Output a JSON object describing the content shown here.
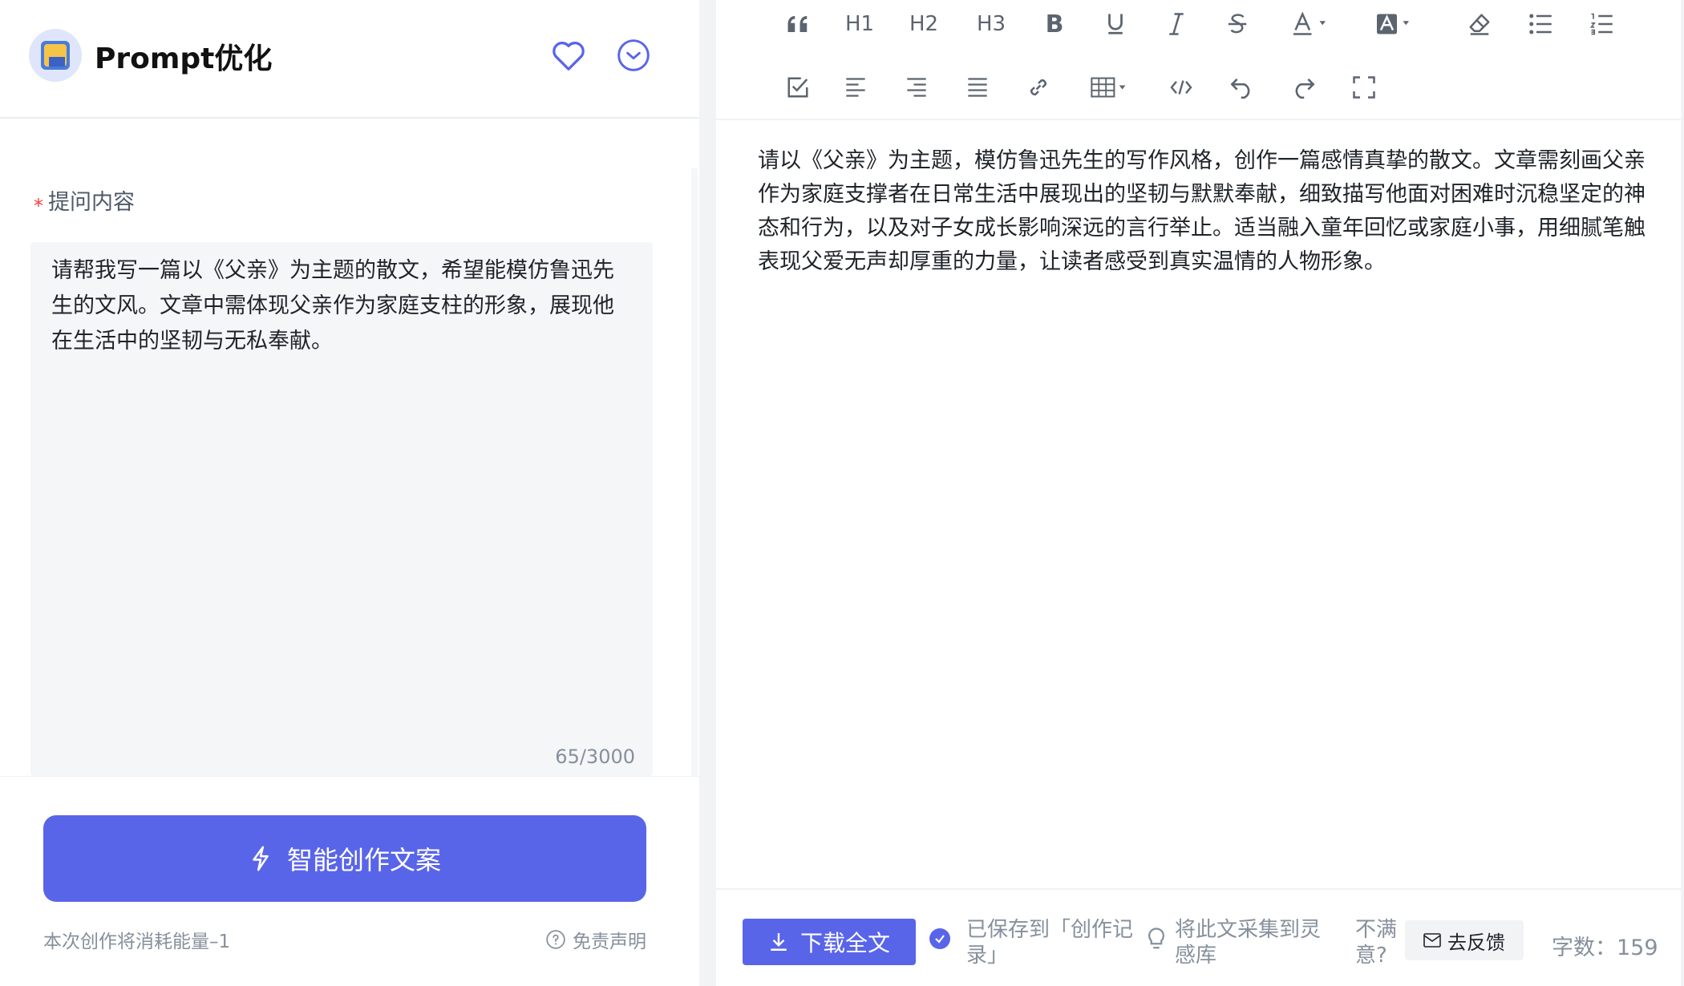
{
  "app": {
    "title": "Prompt优化"
  },
  "form": {
    "label": "提问内容",
    "required_mark": "*",
    "input_text": "请帮我写一篇以《父亲》为主题的散文，希望能模仿鲁迅先生的文风。文章中需体现父亲作为家庭支柱的形象，展现他在生活中的坚韧与无私奉献。",
    "counter": "65/3000"
  },
  "actions": {
    "generate_label": "智能创作文案",
    "cost_text": "本次创作将消耗能量–1",
    "disclaimer_label": "免责声明"
  },
  "toolbar": {
    "h1": "H1",
    "h2": "H2",
    "h3": "H3",
    "row1_icons": [
      "quote-icon",
      "bold-icon",
      "underline-icon",
      "italic-icon",
      "strikethrough-icon",
      "font-color-icon",
      "background-color-icon",
      "clear-format-icon",
      "bullet-list-icon",
      "numbered-list-icon"
    ],
    "row2_icons": [
      "task-list-icon",
      "align-left-icon",
      "align-right-icon",
      "align-justify-icon",
      "link-icon",
      "table-icon",
      "code-icon",
      "undo-icon",
      "redo-icon",
      "fullscreen-icon"
    ]
  },
  "editor": {
    "content": "请以《父亲》为主题，模仿鲁迅先生的写作风格，创作一篇感情真挚的散文。文章需刻画父亲作为家庭支撑者在日常生活中展现出的坚韧与默默奉献，细致描写他面对困难时沉稳坚定的神态和行为，以及对子女成长影响深远的言行举止。适当融入童年回忆或家庭小事，用细腻笔触表现父爱无声却厚重的力量，让读者感受到真实温情的人物形象。"
  },
  "status": {
    "download_label": "下载全文",
    "saved_text": "已保存到「创作记录」",
    "collect_text": "将此文采集到灵感库",
    "unsatisfied_text": "不满意?",
    "feedback_label": "去反馈",
    "word_count_label": "字数：",
    "word_count": "159"
  },
  "colors": {
    "accent": "#5965e8",
    "required": "#f53f3f",
    "muted": "#86909c"
  }
}
